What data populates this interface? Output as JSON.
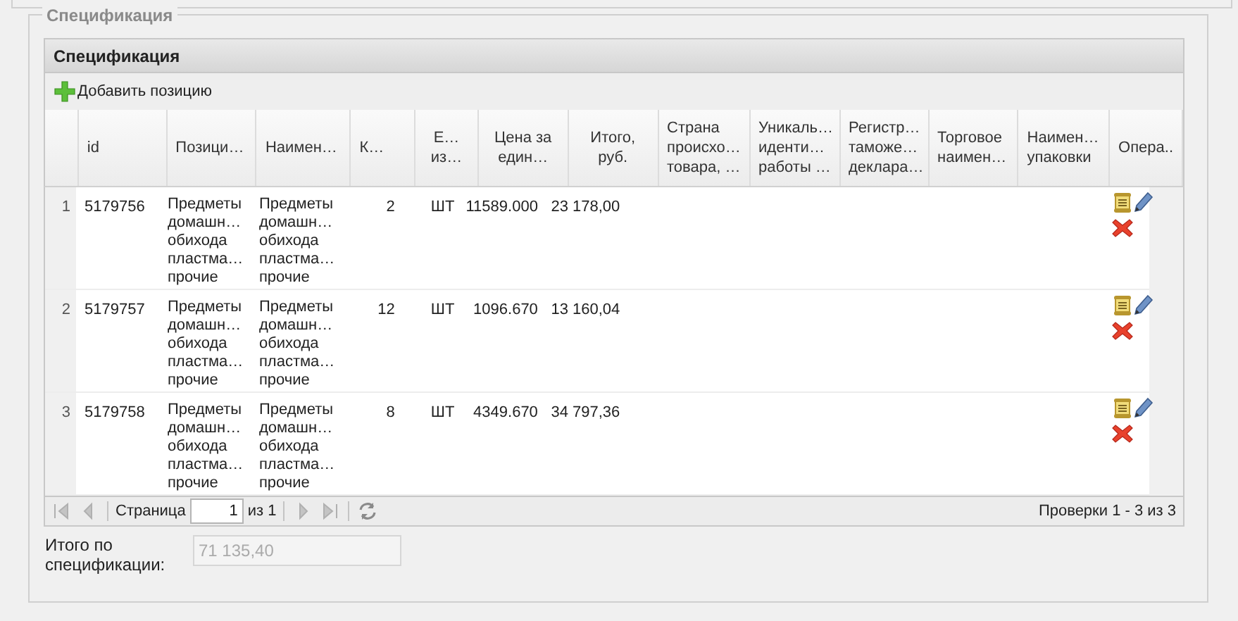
{
  "fieldset": {
    "legend": "Спецификация"
  },
  "panel": {
    "title": "Спецификация"
  },
  "toolbar": {
    "add_button": "Добавить позицию"
  },
  "columns": [
    {
      "lines": [
        "id"
      ]
    },
    {
      "lines": [
        "Позици…"
      ]
    },
    {
      "lines": [
        "Наимен…"
      ]
    },
    {
      "lines": [
        "К…"
      ]
    },
    {
      "lines": [
        "Е…",
        "из…"
      ]
    },
    {
      "lines": [
        "Цена за",
        "един…"
      ]
    },
    {
      "lines": [
        "Итого,",
        "руб."
      ]
    },
    {
      "lines": [
        "Страна",
        "происхо…",
        "товара, …"
      ]
    },
    {
      "lines": [
        "Уникаль…",
        "иденти…",
        "работы …"
      ]
    },
    {
      "lines": [
        "Регистр…",
        "таможе…",
        "деклара…"
      ]
    },
    {
      "lines": [
        "Торговое",
        "наимен…"
      ]
    },
    {
      "lines": [
        "Наимен…",
        "упаковки"
      ]
    },
    {
      "lines": [
        "Опера.."
      ]
    }
  ],
  "rows": [
    {
      "number": "1",
      "id": "5179756",
      "position": [
        "Предметы",
        "домашн…",
        "обихода",
        "пластма…",
        "прочие"
      ],
      "name": [
        "Предметы",
        "домашн…",
        "обихода",
        "пластма…",
        "прочие"
      ],
      "qty": "2",
      "unit": "ШТ",
      "price": "11589.000",
      "total": "23 178,00"
    },
    {
      "number": "2",
      "id": "5179757",
      "position": [
        "Предметы",
        "домашн…",
        "обихода",
        "пластма…",
        "прочие"
      ],
      "name": [
        "Предметы",
        "домашн…",
        "обихода",
        "пластма…",
        "прочие"
      ],
      "qty": "12",
      "unit": "ШТ",
      "price": "1096.670",
      "total": "13 160,04"
    },
    {
      "number": "3",
      "id": "5179758",
      "position": [
        "Предметы",
        "домашн…",
        "обихода",
        "пластма…",
        "прочие"
      ],
      "name": [
        "Предметы",
        "домашн…",
        "обихода",
        "пластма…",
        "прочие"
      ],
      "qty": "8",
      "unit": "ШТ",
      "price": "4349.670",
      "total": "34 797,36"
    }
  ],
  "paging": {
    "page_label": "Страница",
    "page": "1",
    "of_label": "из 1",
    "summary": "Проверки 1 - 3 из 3"
  },
  "total": {
    "label": [
      "Итого по",
      "спецификации:"
    ],
    "value": "71 135,40",
    "disabled": true
  }
}
